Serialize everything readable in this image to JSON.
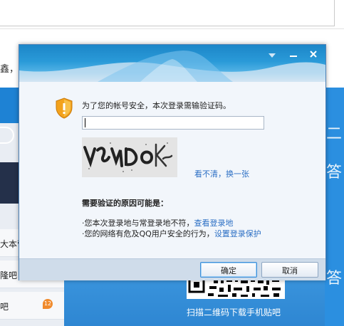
{
  "background": {
    "page_text_fragment": "鑫，才",
    "left_items": [
      {
        "label": "大本营"
      },
      {
        "label": "隆吧"
      },
      {
        "label": "吧",
        "badge": "12"
      }
    ],
    "right_glyph_1": "二",
    "right_glyph_2": "答",
    "right_glyph_3": "答",
    "qr_caption": "扫描二维码下载手机贴吧"
  },
  "dialog": {
    "message": "为了您的帐号安全，本次登录需输验证码。",
    "input_value": "",
    "refresh_link": "看不清，换一张",
    "reason_title": "需要验证的原因可能是：",
    "reasons": [
      {
        "text": "·您本次登录地与常登录地不符，",
        "link": "查看登录地"
      },
      {
        "text": "·您的网络有危及QQ用户安全的行为，",
        "link": "设置登录保护"
      }
    ],
    "ok_label": "确定",
    "cancel_label": "取消",
    "titlebar_icons": {
      "menu": "chevron-down-icon",
      "minimize": "minimize-icon",
      "close": "close-icon"
    }
  },
  "colors": {
    "accent": "#2c6fc4",
    "titlebar": "#1c86c8",
    "page_blue": "#1e82d4"
  }
}
